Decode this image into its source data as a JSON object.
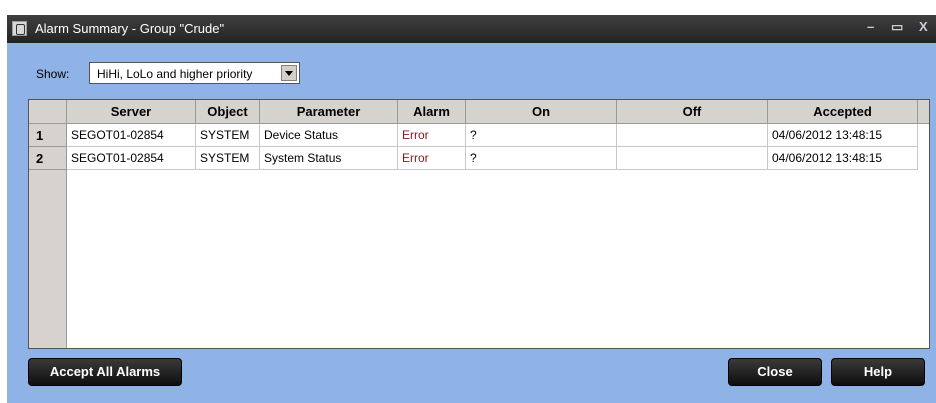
{
  "window": {
    "title": "Alarm Summary - Group \"Crude\"",
    "controls": {
      "minimize": "–",
      "maximize": "▭",
      "close": "X"
    }
  },
  "filter": {
    "label": "Show:",
    "selected": "HiHi, LoLo and higher priority"
  },
  "table": {
    "columns": [
      "Server",
      "Object",
      "Parameter",
      "Alarm",
      "On",
      "Off",
      "Accepted"
    ],
    "rows": [
      {
        "num": "1",
        "server": "SEGOT01-02854",
        "object": "SYSTEM",
        "parameter": "Device Status",
        "alarm": "Error",
        "on": "?",
        "off": "",
        "accepted": "04/06/2012 13:48:15"
      },
      {
        "num": "2",
        "server": "SEGOT01-02854",
        "object": "SYSTEM",
        "parameter": "System Status",
        "alarm": "Error",
        "on": "?",
        "off": "",
        "accepted": "04/06/2012 13:48:15"
      }
    ]
  },
  "buttons": {
    "accept_all": "Accept All Alarms",
    "close": "Close",
    "help": "Help"
  },
  "colors": {
    "background": "#8fb3e6",
    "titlebar": "#2e2e2e",
    "error_text": "#8b1a1a"
  }
}
